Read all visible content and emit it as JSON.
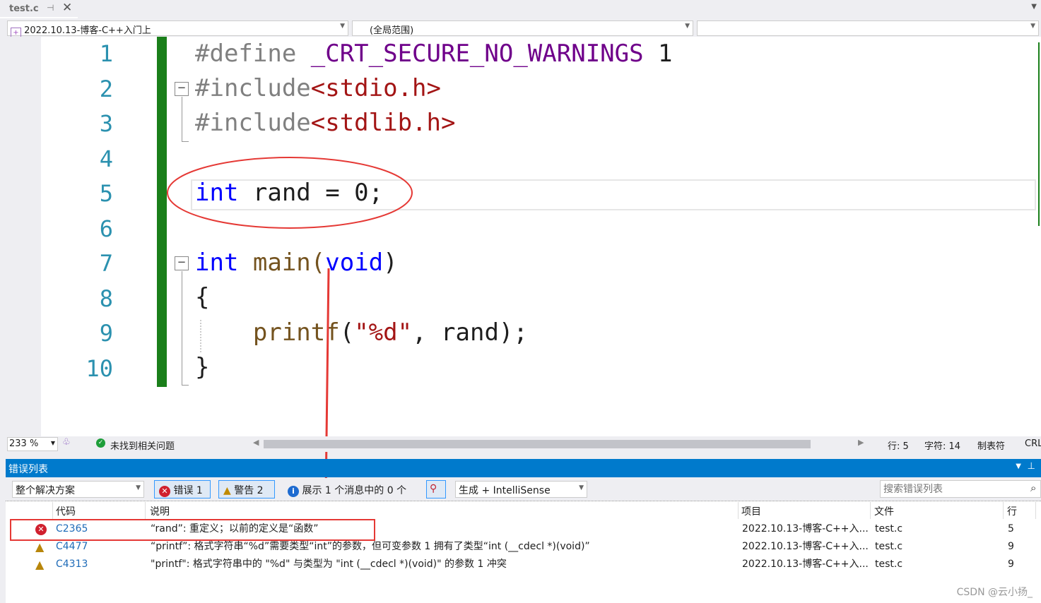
{
  "tab": {
    "title": "test.c",
    "pin": "⊣",
    "close": "✕"
  },
  "nav": {
    "project": "2022.10.13-博客-C++入门上",
    "scope": "(全局范围)",
    "member": ""
  },
  "code": {
    "line_numbers": [
      "1",
      "2",
      "3",
      "4",
      "5",
      "6",
      "7",
      "8",
      "9",
      "10"
    ],
    "l1": {
      "a": "#define ",
      "b": "_CRT_SECURE_NO_WARNINGS",
      "c": " 1"
    },
    "l2": {
      "a": "#include",
      "b": "<stdio.h>"
    },
    "l3": {
      "a": "#include",
      "b": "<stdlib.h>"
    },
    "l5": {
      "a": "int",
      "b": " rand = 0;"
    },
    "l7": {
      "a": "int",
      "b": " main(",
      "c": "void",
      "d": ")"
    },
    "l8": "{",
    "l9": {
      "a": "    ",
      "b": "printf",
      "c": "(",
      "d": "\"%d\"",
      "e": ", rand);"
    },
    "l10": "}"
  },
  "status": {
    "zoom": "233 %",
    "issues": "未找到相关问题",
    "line": "行: 5",
    "char": "字符: 14",
    "tabs": "制表符",
    "eol": "CRL"
  },
  "error_list": {
    "title": "错误列表",
    "scope": "整个解决方案",
    "errors": "错误 1",
    "warnings": "警告 2",
    "messages": "展示 1 个消息中的 0 个",
    "source": "生成 + IntelliSense",
    "search_placeholder": "搜索错误列表",
    "columns": [
      "代码",
      "说明",
      "项目",
      "文件",
      "行"
    ],
    "rows": [
      {
        "type": "error",
        "code": "C2365",
        "desc": "“rand”: 重定义；以前的定义是“函数”",
        "project": "2022.10.13-博客-C++入...",
        "file": "test.c",
        "line": "5"
      },
      {
        "type": "warning",
        "code": "C4477",
        "desc": "“printf”: 格式字符串“%d”需要类型“int”的参数，但可变参数 1 拥有了类型“int (__cdecl *)(void)”",
        "project": "2022.10.13-博客-C++入...",
        "file": "test.c",
        "line": "9"
      },
      {
        "type": "warning",
        "code": "C4313",
        "desc": "\"printf\": 格式字符串中的 \"%d\" 与类型为 \"int (__cdecl *)(void)\" 的参数 1 冲突",
        "project": "2022.10.13-博客-C++入...",
        "file": "test.c",
        "line": "9"
      }
    ]
  },
  "watermark": "CSDN @云小扬_",
  "colors": {
    "annotation": "#e53935",
    "accent": "#007acc",
    "change_bar": "#1a7f1a"
  }
}
